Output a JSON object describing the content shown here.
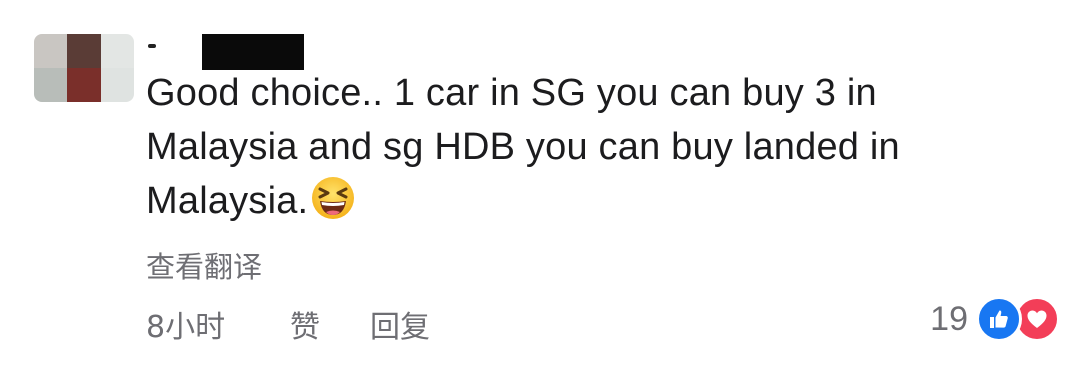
{
  "comment": {
    "text_line1": "Good choice.. 1 car in SG you can buy 3 in",
    "text_line2": "Malaysia and sg HDB you can buy landed in",
    "text_line3": "Malaysia.",
    "emoji": "grinning-squinting-face",
    "translate_label": "查看翻译",
    "time": "8小时",
    "like_label": "赞",
    "reply_label": "回复",
    "reaction_count": "19",
    "reactions": [
      "like-icon",
      "love-icon"
    ]
  },
  "colors": {
    "like": "#1877f2",
    "love": "#f33e58",
    "meta_text": "#6e6e73",
    "text": "#1c1c1e"
  }
}
